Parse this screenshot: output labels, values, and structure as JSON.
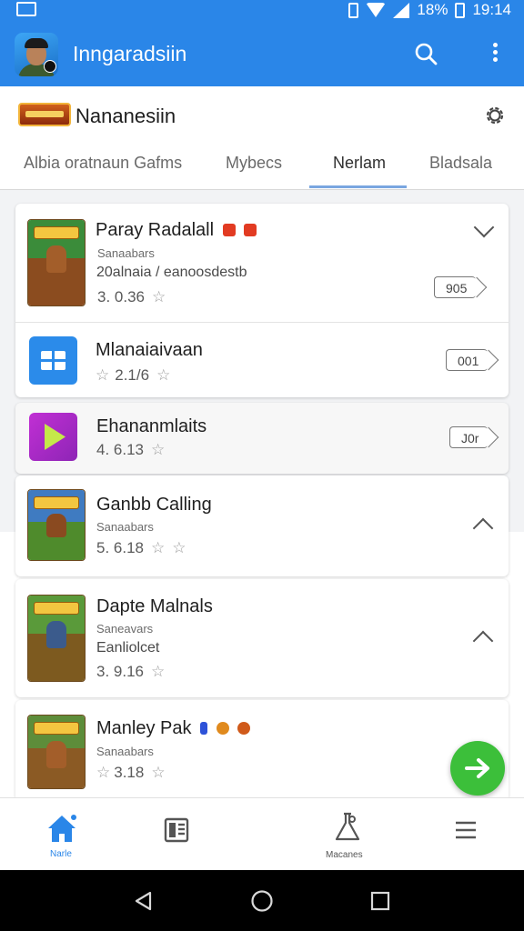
{
  "status_bar": {
    "battery": "18%",
    "time": "19:14"
  },
  "app_bar": {
    "title": "Inngaradsiin"
  },
  "header": {
    "section_title": "Nananesiin",
    "tabs": [
      {
        "label": "Albia oratnaun Gafms",
        "active": false
      },
      {
        "label": "Mybecs",
        "active": false
      },
      {
        "label": "Nerlam",
        "active": true
      },
      {
        "label": "Bladsala",
        "active": false
      }
    ]
  },
  "apps": [
    {
      "name": "Paray Radalall",
      "sub": "Sanaabars",
      "desc": "20alnaia / eanoosdestb",
      "rating": "3. 0.36",
      "stars": 1,
      "tag": "905",
      "action": "chevron-down-icon"
    },
    {
      "name": "Mlanaiaivaan",
      "rating": "2.1/6",
      "stars": 1,
      "tag": "001"
    },
    {
      "name": "Ehananmlaits",
      "rating": "4. 6.13",
      "stars": 1,
      "tag": "J0r"
    },
    {
      "name": "Ganbb Calling",
      "sub": "Sanaabars",
      "rating": "5. 6.18",
      "stars": 2,
      "action": "chevron-up-icon"
    },
    {
      "name": "Dapte Malnals",
      "sub": "Saneavars",
      "desc": "Eanliolcet",
      "rating": "3. 9.16",
      "stars": 1,
      "action": "chevron-up-icon"
    },
    {
      "name": "Manley Pak",
      "sub": "Sanaabars",
      "rating": "3.18",
      "stars": 2
    }
  ],
  "bottom_nav": [
    {
      "label": "Narle",
      "icon": "home-icon",
      "active": true
    },
    {
      "label": "",
      "icon": "library-icon",
      "active": false
    },
    {
      "label": "Macanes",
      "icon": "flask-icon",
      "active": false
    },
    {
      "label": "",
      "icon": "menu-icon",
      "active": false
    }
  ],
  "colors": {
    "primary": "#2a86e8",
    "fab": "#3cbf3a",
    "tab_indicator": "#7aa6e0"
  }
}
